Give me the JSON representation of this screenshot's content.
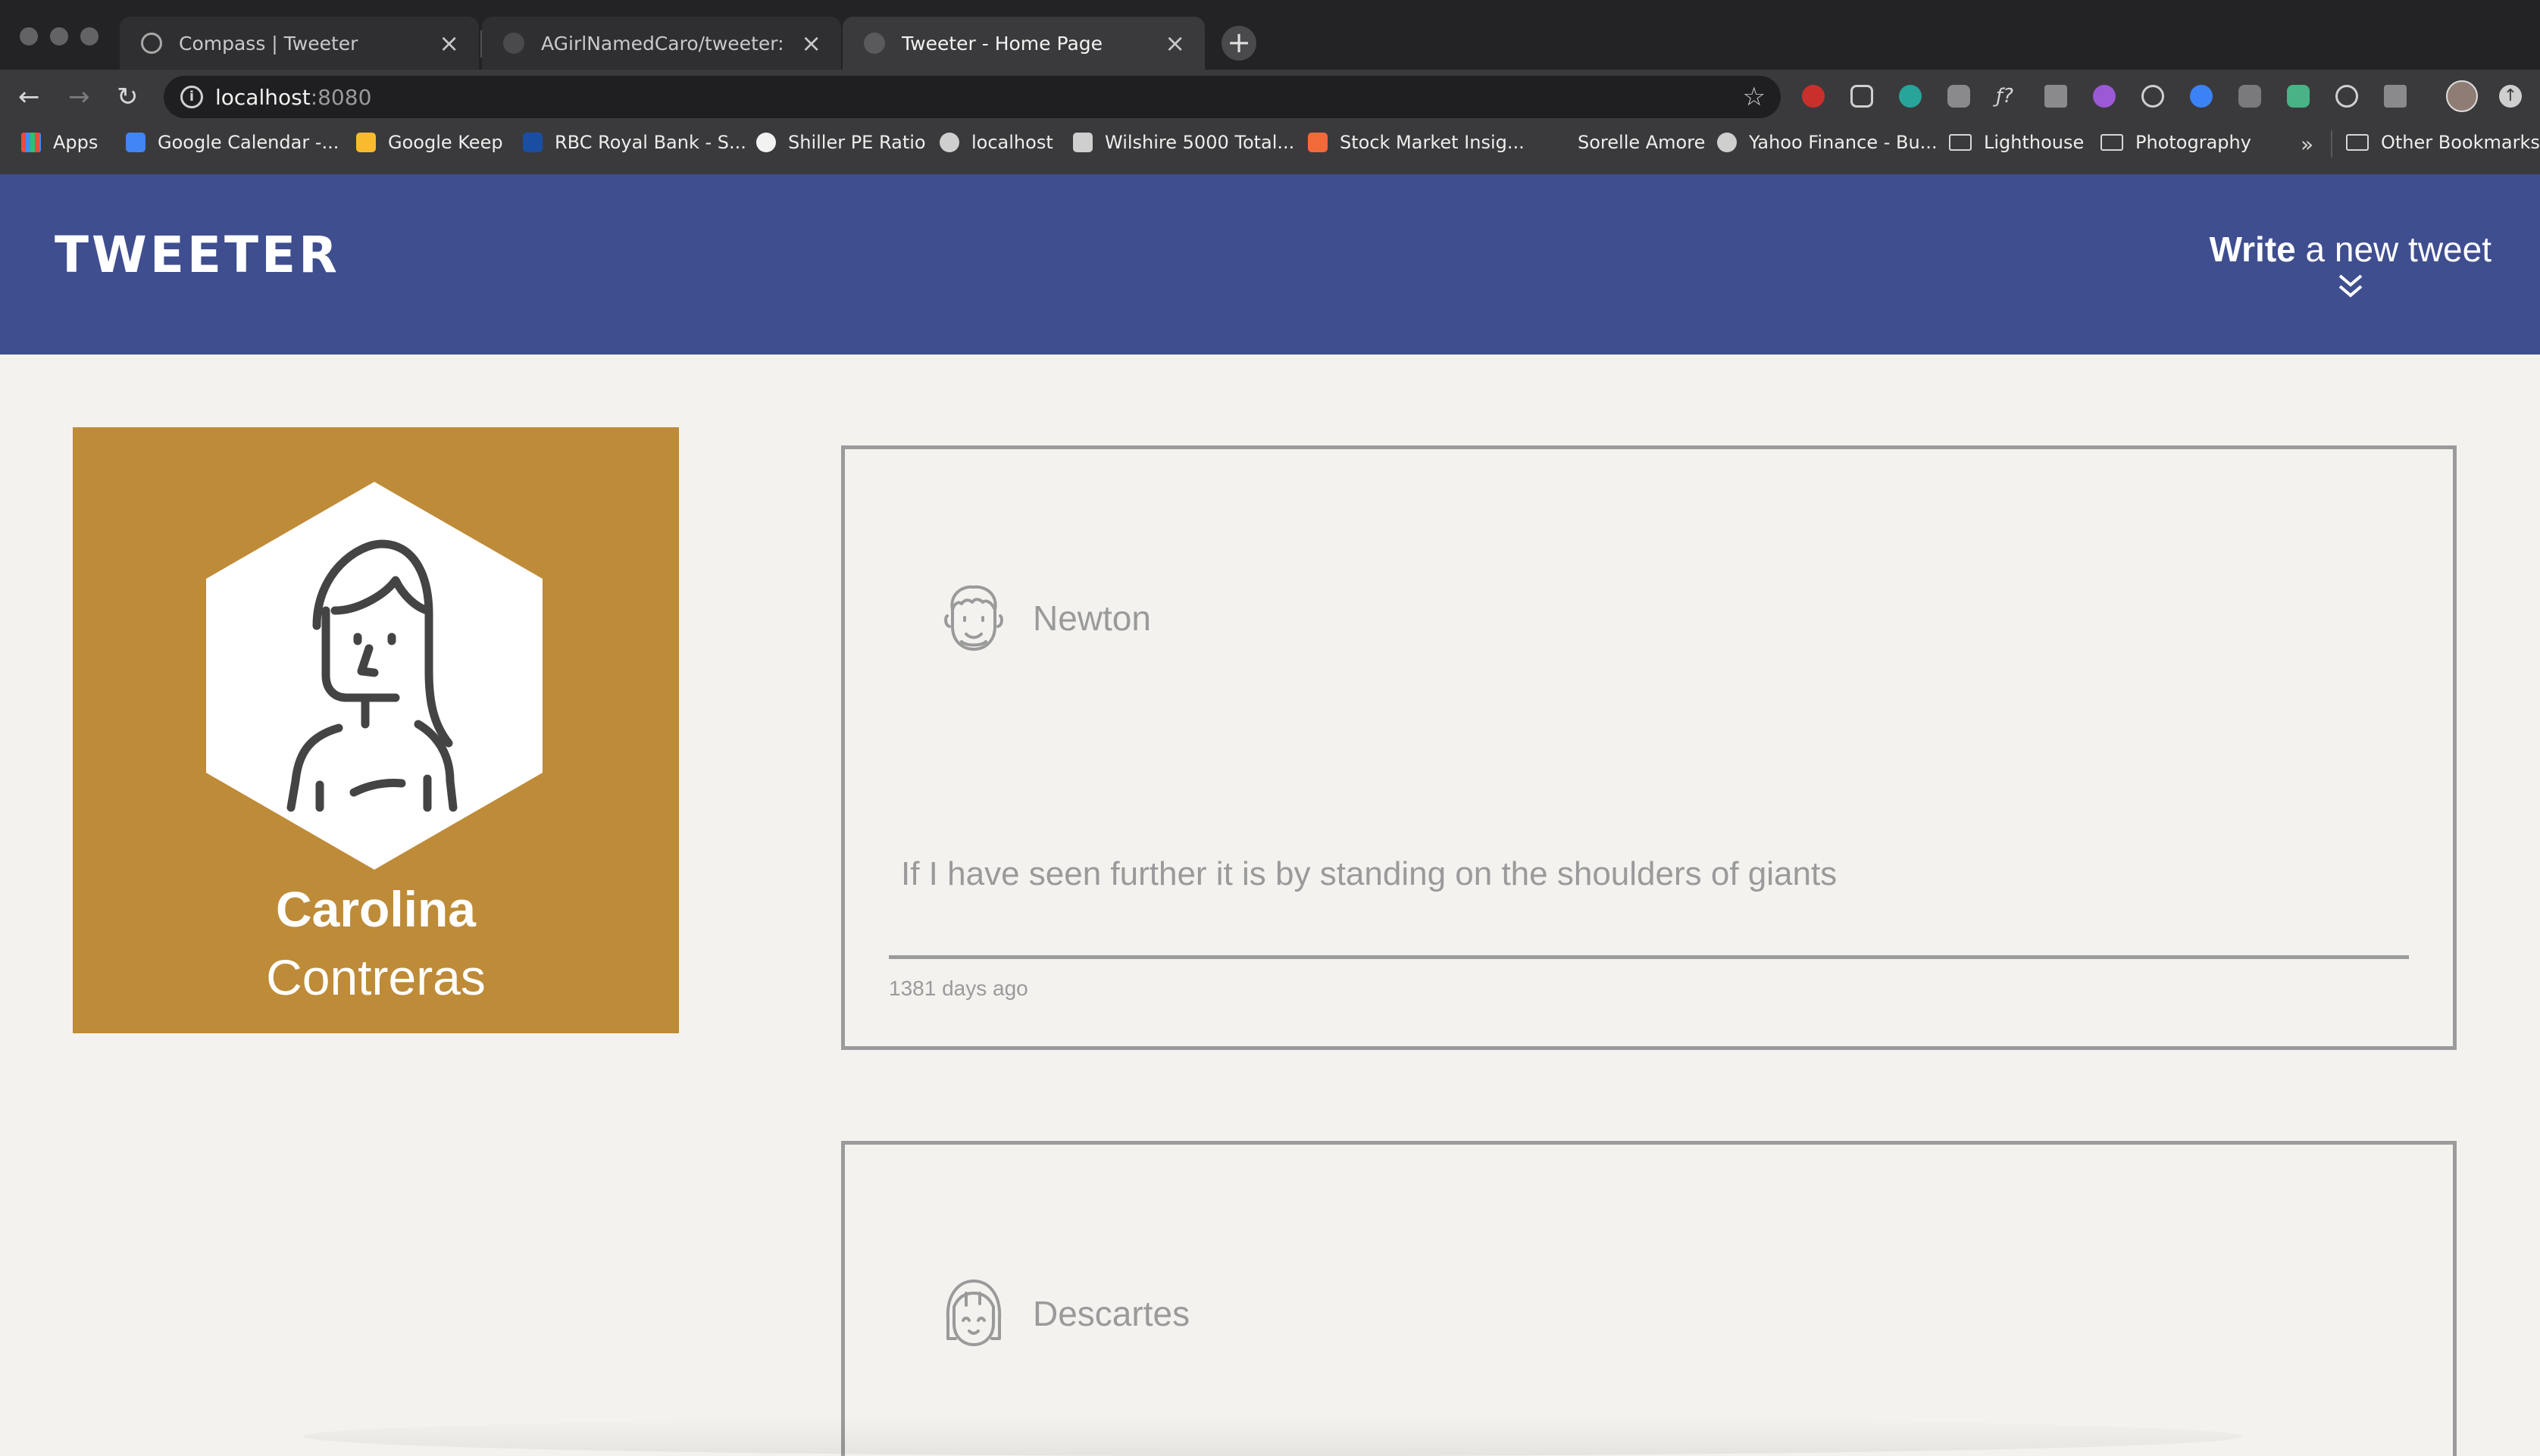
{
  "browser": {
    "tabs": [
      {
        "title": "Compass | Tweeter",
        "active": false
      },
      {
        "title": "AGirlNamedCaro/tweeter: A twit",
        "active": false
      },
      {
        "title": "Tweeter - Home Page",
        "active": true
      }
    ],
    "new_tab_symbol": "+",
    "close_symbol": "×",
    "address": {
      "host": "localhost",
      "port": ":8080"
    },
    "bookmarks": [
      {
        "label": "Apps",
        "icon": "apps-grid-icon"
      },
      {
        "label": "Google Calendar -...",
        "icon": "google-calendar-icon"
      },
      {
        "label": "Google Keep",
        "icon": "google-keep-icon"
      },
      {
        "label": "RBC Royal Bank - S...",
        "icon": "rbc-icon"
      },
      {
        "label": "Shiller PE Ratio",
        "icon": "globe-icon"
      },
      {
        "label": "localhost",
        "icon": "globe-icon"
      },
      {
        "label": "Wilshire 5000 Total...",
        "icon": "chart-icon"
      },
      {
        "label": "Stock Market Insig...",
        "icon": "alpha-icon"
      },
      {
        "label": "Sorelle Amore",
        "icon": "blank-icon"
      },
      {
        "label": "Yahoo Finance - Bu...",
        "icon": "globe-icon"
      },
      {
        "label": "Lighthouse",
        "icon": "folder-icon"
      },
      {
        "label": "Photography",
        "icon": "folder-icon"
      }
    ],
    "more_bookmarks": "»",
    "other_bookmarks": "Other Bookmarks"
  },
  "header": {
    "logo": "TWEETER",
    "compose_bold": "Write",
    "compose_rest": " a new tweet"
  },
  "profile": {
    "first_name": "Carolina",
    "last_name": "Contreras",
    "accent": "#be8b38"
  },
  "tweets": [
    {
      "author": "Newton",
      "avatar_icon": "curly-hair-face-icon",
      "text": "If I have seen further it is by standing on the shoulders of giants",
      "time": "1381 days ago"
    },
    {
      "author": "Descartes",
      "avatar_icon": "bangs-face-icon",
      "text": "",
      "time": ""
    }
  ],
  "colors": {
    "header_bg": "#3f4e8f",
    "page_bg": "#f4f2ee",
    "tweet_border": "#9b9b9b",
    "tweet_text": "#9a9a9a"
  }
}
